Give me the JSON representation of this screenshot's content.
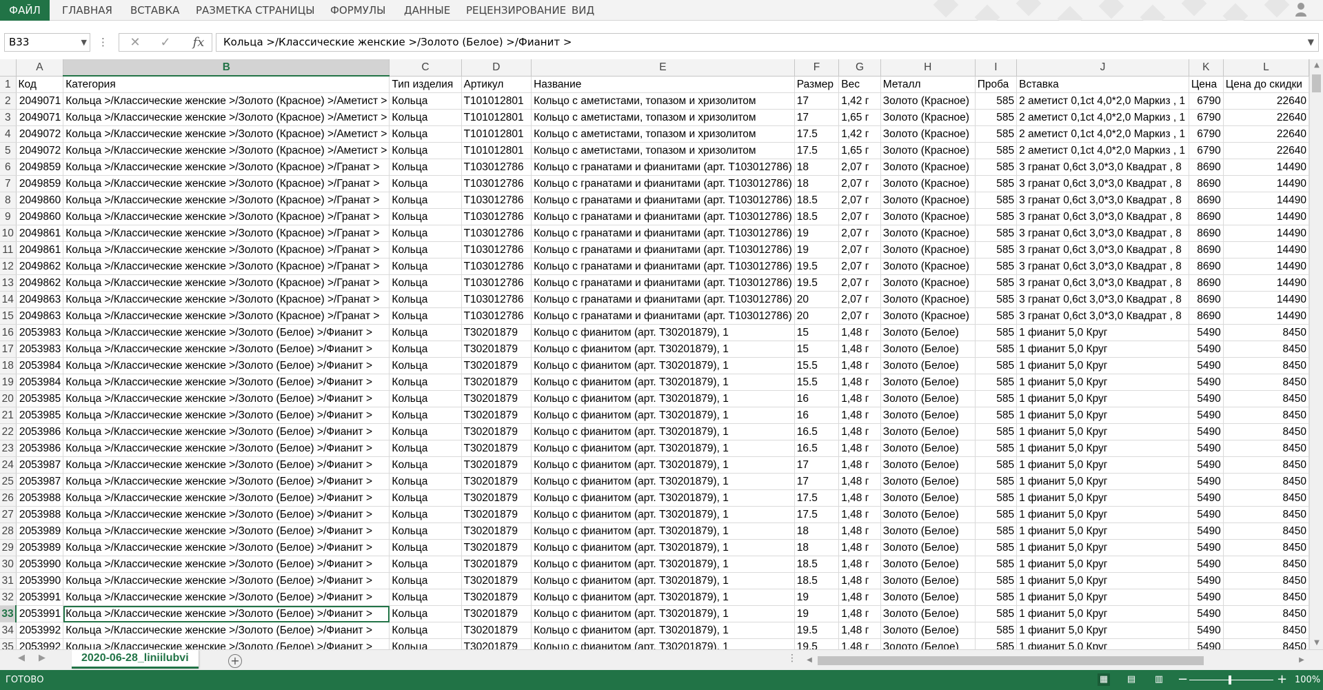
{
  "ribbon": {
    "tabs": [
      {
        "label": "ФАЙЛ",
        "active": true
      },
      {
        "label": "ГЛАВНАЯ"
      },
      {
        "label": "ВСТАВКА"
      },
      {
        "label": "РАЗМЕТКА СТРАНИЦЫ"
      },
      {
        "label": "ФОРМУЛЫ"
      },
      {
        "label": "ДАННЫЕ"
      },
      {
        "label": "РЕЦЕНЗИРОВАНИЕ"
      },
      {
        "label": "ВИД"
      }
    ],
    "account_icon": "user-icon"
  },
  "formula_bar": {
    "name_box": "B33",
    "cancel_icon": "close-icon",
    "enter_icon": "check-icon",
    "function_icon": "fx",
    "formula": "Кольца >/Классические женские >/Золото (Белое) >/Фианит >"
  },
  "grid": {
    "active_column": "B",
    "active_row": 33,
    "columns": [
      "A",
      "B",
      "C",
      "D",
      "E",
      "F",
      "G",
      "H",
      "I",
      "J",
      "K",
      "L"
    ],
    "rows": [
      {
        "n": 1,
        "cells": [
          "Код",
          "Категория",
          "Тип изделия",
          "Артикул",
          "Название",
          "Размер",
          "Вес",
          "Металл",
          "Проба",
          "Вставка",
          "Цена",
          "Цена до скидки"
        ]
      },
      {
        "n": 2,
        "cells": [
          "2049071",
          "Кольца >/Классические женские >/Золото (Красное) >/Аметист >",
          "Кольца",
          "T101012801",
          "Кольцо с аметистами, топазом и хризолитом",
          "17",
          "1,42 г",
          "Золото (Красное)",
          "585",
          "2 аметист 0,1ct 4,0*2,0 Маркиз , 1",
          "6790",
          "22640"
        ]
      },
      {
        "n": 3,
        "cells": [
          "2049071",
          "Кольца >/Классические женские >/Золото (Красное) >/Аметист >",
          "Кольца",
          "T101012801",
          "Кольцо с аметистами, топазом и хризолитом",
          "17",
          "1,65 г",
          "Золото (Красное)",
          "585",
          "2 аметист 0,1ct 4,0*2,0 Маркиз , 1",
          "6790",
          "22640"
        ]
      },
      {
        "n": 4,
        "cells": [
          "2049072",
          "Кольца >/Классические женские >/Золото (Красное) >/Аметист >",
          "Кольца",
          "T101012801",
          "Кольцо с аметистами, топазом и хризолитом",
          "17.5",
          "1,42 г",
          "Золото (Красное)",
          "585",
          "2 аметист 0,1ct 4,0*2,0 Маркиз , 1",
          "6790",
          "22640"
        ]
      },
      {
        "n": 5,
        "cells": [
          "2049072",
          "Кольца >/Классические женские >/Золото (Красное) >/Аметист >",
          "Кольца",
          "T101012801",
          "Кольцо с аметистами, топазом и хризолитом",
          "17.5",
          "1,65 г",
          "Золото (Красное)",
          "585",
          "2 аметист 0,1ct 4,0*2,0 Маркиз , 1",
          "6790",
          "22640"
        ]
      },
      {
        "n": 6,
        "cells": [
          "2049859",
          "Кольца >/Классические женские >/Золото (Красное) >/Гранат >",
          "Кольца",
          "T103012786",
          "Кольцо с гранатами и фианитами (арт. T103012786)",
          "18",
          "2,07 г",
          "Золото (Красное)",
          "585",
          "3 гранат 0,6ct 3,0*3,0 Квадрат , 8",
          "8690",
          "14490"
        ]
      },
      {
        "n": 7,
        "cells": [
          "2049859",
          "Кольца >/Классические женские >/Золото (Красное) >/Гранат >",
          "Кольца",
          "T103012786",
          "Кольцо с гранатами и фианитами (арт. T103012786)",
          "18",
          "2,07 г",
          "Золото (Красное)",
          "585",
          "3 гранат 0,6ct 3,0*3,0 Квадрат , 8",
          "8690",
          "14490"
        ]
      },
      {
        "n": 8,
        "cells": [
          "2049860",
          "Кольца >/Классические женские >/Золото (Красное) >/Гранат >",
          "Кольца",
          "T103012786",
          "Кольцо с гранатами и фианитами (арт. T103012786)",
          "18.5",
          "2,07 г",
          "Золото (Красное)",
          "585",
          "3 гранат 0,6ct 3,0*3,0 Квадрат , 8",
          "8690",
          "14490"
        ]
      },
      {
        "n": 9,
        "cells": [
          "2049860",
          "Кольца >/Классические женские >/Золото (Красное) >/Гранат >",
          "Кольца",
          "T103012786",
          "Кольцо с гранатами и фианитами (арт. T103012786)",
          "18.5",
          "2,07 г",
          "Золото (Красное)",
          "585",
          "3 гранат 0,6ct 3,0*3,0 Квадрат , 8",
          "8690",
          "14490"
        ]
      },
      {
        "n": 10,
        "cells": [
          "2049861",
          "Кольца >/Классические женские >/Золото (Красное) >/Гранат >",
          "Кольца",
          "T103012786",
          "Кольцо с гранатами и фианитами (арт. T103012786)",
          "19",
          "2,07 г",
          "Золото (Красное)",
          "585",
          "3 гранат 0,6ct 3,0*3,0 Квадрат , 8",
          "8690",
          "14490"
        ]
      },
      {
        "n": 11,
        "cells": [
          "2049861",
          "Кольца >/Классические женские >/Золото (Красное) >/Гранат >",
          "Кольца",
          "T103012786",
          "Кольцо с гранатами и фианитами (арт. T103012786)",
          "19",
          "2,07 г",
          "Золото (Красное)",
          "585",
          "3 гранат 0,6ct 3,0*3,0 Квадрат , 8",
          "8690",
          "14490"
        ]
      },
      {
        "n": 12,
        "cells": [
          "2049862",
          "Кольца >/Классические женские >/Золото (Красное) >/Гранат >",
          "Кольца",
          "T103012786",
          "Кольцо с гранатами и фианитами (арт. T103012786)",
          "19.5",
          "2,07 г",
          "Золото (Красное)",
          "585",
          "3 гранат 0,6ct 3,0*3,0 Квадрат , 8",
          "8690",
          "14490"
        ]
      },
      {
        "n": 13,
        "cells": [
          "2049862",
          "Кольца >/Классические женские >/Золото (Красное) >/Гранат >",
          "Кольца",
          "T103012786",
          "Кольцо с гранатами и фианитами (арт. T103012786)",
          "19.5",
          "2,07 г",
          "Золото (Красное)",
          "585",
          "3 гранат 0,6ct 3,0*3,0 Квадрат , 8",
          "8690",
          "14490"
        ]
      },
      {
        "n": 14,
        "cells": [
          "2049863",
          "Кольца >/Классические женские >/Золото (Красное) >/Гранат >",
          "Кольца",
          "T103012786",
          "Кольцо с гранатами и фианитами (арт. T103012786)",
          "20",
          "2,07 г",
          "Золото (Красное)",
          "585",
          "3 гранат 0,6ct 3,0*3,0 Квадрат , 8",
          "8690",
          "14490"
        ]
      },
      {
        "n": 15,
        "cells": [
          "2049863",
          "Кольца >/Классические женские >/Золото (Красное) >/Гранат >",
          "Кольца",
          "T103012786",
          "Кольцо с гранатами и фианитами (арт. T103012786)",
          "20",
          "2,07 г",
          "Золото (Красное)",
          "585",
          "3 гранат 0,6ct 3,0*3,0 Квадрат , 8",
          "8690",
          "14490"
        ]
      },
      {
        "n": 16,
        "cells": [
          "2053983",
          "Кольца >/Классические женские >/Золото (Белое) >/Фианит >",
          "Кольца",
          "T30201879",
          "Кольцо с фианитом (арт. T30201879), 1",
          "15",
          "1,48 г",
          "Золото (Белое)",
          "585",
          "1 фианит 5,0 Круг",
          "5490",
          "8450"
        ]
      },
      {
        "n": 17,
        "cells": [
          "2053983",
          "Кольца >/Классические женские >/Золото (Белое) >/Фианит >",
          "Кольца",
          "T30201879",
          "Кольцо с фианитом (арт. T30201879), 1",
          "15",
          "1,48 г",
          "Золото (Белое)",
          "585",
          "1 фианит 5,0 Круг",
          "5490",
          "8450"
        ]
      },
      {
        "n": 18,
        "cells": [
          "2053984",
          "Кольца >/Классические женские >/Золото (Белое) >/Фианит >",
          "Кольца",
          "T30201879",
          "Кольцо с фианитом (арт. T30201879), 1",
          "15.5",
          "1,48 г",
          "Золото (Белое)",
          "585",
          "1 фианит 5,0 Круг",
          "5490",
          "8450"
        ]
      },
      {
        "n": 19,
        "cells": [
          "2053984",
          "Кольца >/Классические женские >/Золото (Белое) >/Фианит >",
          "Кольца",
          "T30201879",
          "Кольцо с фианитом (арт. T30201879), 1",
          "15.5",
          "1,48 г",
          "Золото (Белое)",
          "585",
          "1 фианит 5,0 Круг",
          "5490",
          "8450"
        ]
      },
      {
        "n": 20,
        "cells": [
          "2053985",
          "Кольца >/Классические женские >/Золото (Белое) >/Фианит >",
          "Кольца",
          "T30201879",
          "Кольцо с фианитом (арт. T30201879), 1",
          "16",
          "1,48 г",
          "Золото (Белое)",
          "585",
          "1 фианит 5,0 Круг",
          "5490",
          "8450"
        ]
      },
      {
        "n": 21,
        "cells": [
          "2053985",
          "Кольца >/Классические женские >/Золото (Белое) >/Фианит >",
          "Кольца",
          "T30201879",
          "Кольцо с фианитом (арт. T30201879), 1",
          "16",
          "1,48 г",
          "Золото (Белое)",
          "585",
          "1 фианит 5,0 Круг",
          "5490",
          "8450"
        ]
      },
      {
        "n": 22,
        "cells": [
          "2053986",
          "Кольца >/Классические женские >/Золото (Белое) >/Фианит >",
          "Кольца",
          "T30201879",
          "Кольцо с фианитом (арт. T30201879), 1",
          "16.5",
          "1,48 г",
          "Золото (Белое)",
          "585",
          "1 фианит 5,0 Круг",
          "5490",
          "8450"
        ]
      },
      {
        "n": 23,
        "cells": [
          "2053986",
          "Кольца >/Классические женские >/Золото (Белое) >/Фианит >",
          "Кольца",
          "T30201879",
          "Кольцо с фианитом (арт. T30201879), 1",
          "16.5",
          "1,48 г",
          "Золото (Белое)",
          "585",
          "1 фианит 5,0 Круг",
          "5490",
          "8450"
        ]
      },
      {
        "n": 24,
        "cells": [
          "2053987",
          "Кольца >/Классические женские >/Золото (Белое) >/Фианит >",
          "Кольца",
          "T30201879",
          "Кольцо с фианитом (арт. T30201879), 1",
          "17",
          "1,48 г",
          "Золото (Белое)",
          "585",
          "1 фианит 5,0 Круг",
          "5490",
          "8450"
        ]
      },
      {
        "n": 25,
        "cells": [
          "2053987",
          "Кольца >/Классические женские >/Золото (Белое) >/Фианит >",
          "Кольца",
          "T30201879",
          "Кольцо с фианитом (арт. T30201879), 1",
          "17",
          "1,48 г",
          "Золото (Белое)",
          "585",
          "1 фианит 5,0 Круг",
          "5490",
          "8450"
        ]
      },
      {
        "n": 26,
        "cells": [
          "2053988",
          "Кольца >/Классические женские >/Золото (Белое) >/Фианит >",
          "Кольца",
          "T30201879",
          "Кольцо с фианитом (арт. T30201879), 1",
          "17.5",
          "1,48 г",
          "Золото (Белое)",
          "585",
          "1 фианит 5,0 Круг",
          "5490",
          "8450"
        ]
      },
      {
        "n": 27,
        "cells": [
          "2053988",
          "Кольца >/Классические женские >/Золото (Белое) >/Фианит >",
          "Кольца",
          "T30201879",
          "Кольцо с фианитом (арт. T30201879), 1",
          "17.5",
          "1,48 г",
          "Золото (Белое)",
          "585",
          "1 фианит 5,0 Круг",
          "5490",
          "8450"
        ]
      },
      {
        "n": 28,
        "cells": [
          "2053989",
          "Кольца >/Классические женские >/Золото (Белое) >/Фианит >",
          "Кольца",
          "T30201879",
          "Кольцо с фианитом (арт. T30201879), 1",
          "18",
          "1,48 г",
          "Золото (Белое)",
          "585",
          "1 фианит 5,0 Круг",
          "5490",
          "8450"
        ]
      },
      {
        "n": 29,
        "cells": [
          "2053989",
          "Кольца >/Классические женские >/Золото (Белое) >/Фианит >",
          "Кольца",
          "T30201879",
          "Кольцо с фианитом (арт. T30201879), 1",
          "18",
          "1,48 г",
          "Золото (Белое)",
          "585",
          "1 фианит 5,0 Круг",
          "5490",
          "8450"
        ]
      },
      {
        "n": 30,
        "cells": [
          "2053990",
          "Кольца >/Классические женские >/Золото (Белое) >/Фианит >",
          "Кольца",
          "T30201879",
          "Кольцо с фианитом (арт. T30201879), 1",
          "18.5",
          "1,48 г",
          "Золото (Белое)",
          "585",
          "1 фианит 5,0 Круг",
          "5490",
          "8450"
        ]
      },
      {
        "n": 31,
        "cells": [
          "2053990",
          "Кольца >/Классические женские >/Золото (Белое) >/Фианит >",
          "Кольца",
          "T30201879",
          "Кольцо с фианитом (арт. T30201879), 1",
          "18.5",
          "1,48 г",
          "Золото (Белое)",
          "585",
          "1 фианит 5,0 Круг",
          "5490",
          "8450"
        ]
      },
      {
        "n": 32,
        "cells": [
          "2053991",
          "Кольца >/Классические женские >/Золото (Белое) >/Фианит >",
          "Кольца",
          "T30201879",
          "Кольцо с фианитом (арт. T30201879), 1",
          "19",
          "1,48 г",
          "Золото (Белое)",
          "585",
          "1 фианит 5,0 Круг",
          "5490",
          "8450"
        ]
      },
      {
        "n": 33,
        "cells": [
          "2053991",
          "Кольца >/Классические женские >/Золото (Белое) >/Фианит >",
          "Кольца",
          "T30201879",
          "Кольцо с фианитом (арт. T30201879), 1",
          "19",
          "1,48 г",
          "Золото (Белое)",
          "585",
          "1 фианит 5,0 Круг",
          "5490",
          "8450"
        ]
      },
      {
        "n": 34,
        "cells": [
          "2053992",
          "Кольца >/Классические женские >/Золото (Белое) >/Фианит >",
          "Кольца",
          "T30201879",
          "Кольцо с фианитом (арт. T30201879), 1",
          "19.5",
          "1,48 г",
          "Золото (Белое)",
          "585",
          "1 фианит 5,0 Круг",
          "5490",
          "8450"
        ]
      },
      {
        "n": 35,
        "cells": [
          "2053992",
          "Кольца >/Классические женские >/Золото (Белое) >/Фианит >",
          "Кольца",
          "T30201879",
          "Кольцо с фианитом (арт. T30201879), 1",
          "19.5",
          "1,48 г",
          "Золото (Белое)",
          "585",
          "1 фианит 5,0 Круг",
          "5490",
          "8450"
        ]
      }
    ]
  },
  "sheets": {
    "tabs": [
      "2020-06-28_liniilubvi"
    ],
    "add_icon": "plus-circle-icon"
  },
  "status_bar": {
    "status": "ГОТОВО",
    "zoom": "100%",
    "view_icons": [
      "normal-view-icon",
      "page-layout-icon",
      "page-break-icon"
    ],
    "colors": {
      "accent": "#217346"
    }
  }
}
